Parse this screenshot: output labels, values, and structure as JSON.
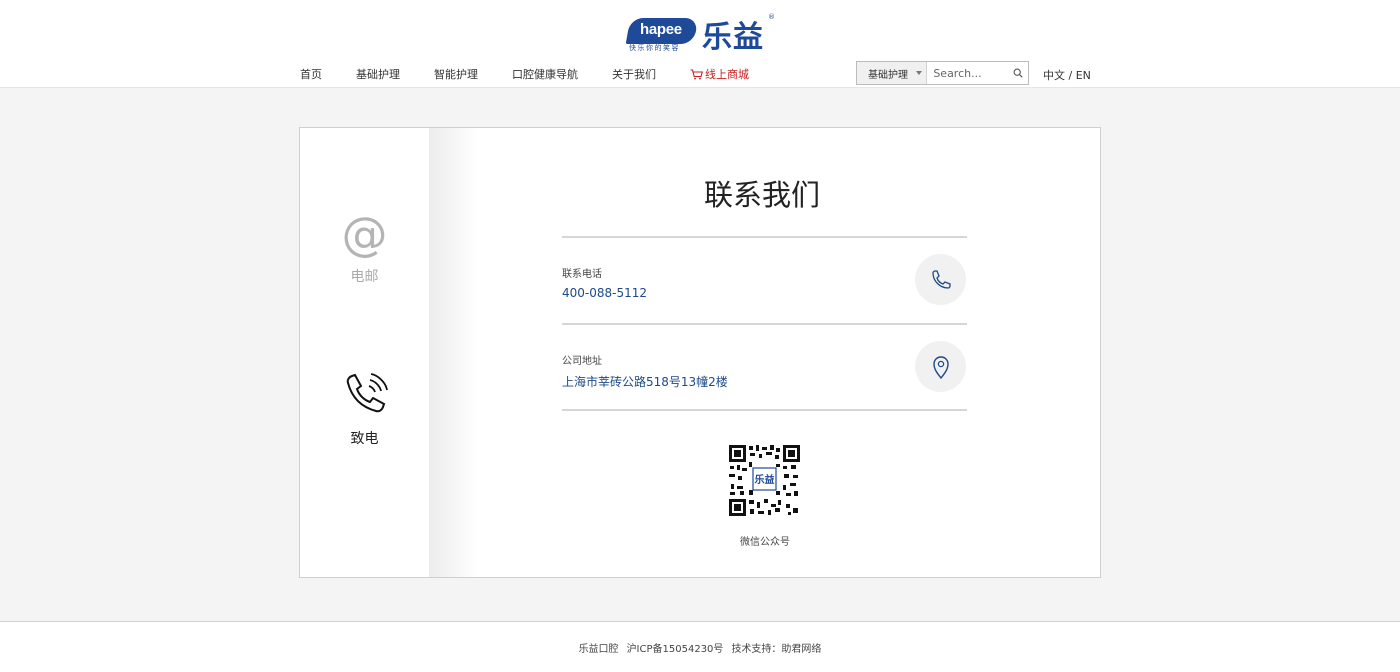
{
  "logo": {
    "en": "hapee",
    "cn": "乐益",
    "slogan": "快乐你的笑容",
    "reg_mark": "®"
  },
  "nav": {
    "items": [
      {
        "label": "首页"
      },
      {
        "label": "基础护理"
      },
      {
        "label": "智能护理"
      },
      {
        "label": "口腔健康导航"
      },
      {
        "label": "关于我们"
      }
    ],
    "shop_label": "线上商城"
  },
  "search": {
    "category": "基础护理",
    "placeholder": "Search..."
  },
  "lang": "中文 / EN",
  "side": {
    "email_label": "电邮",
    "call_label": "致电"
  },
  "contact": {
    "title": "联系我们",
    "phone_label": "联系电话",
    "phone_value": "400-088-5112",
    "address_label": "公司地址",
    "address_value": "上海市莘砖公路518号13幢2楼",
    "qr_label": "微信公众号"
  },
  "footer": {
    "brand": "乐益口腔",
    "icp": "沪ICP备15054230号",
    "support": "技术支持：助君网络"
  },
  "colors": {
    "brand_blue": "#1e4a99",
    "link_blue": "#1e4a87",
    "shop_red": "#c81e1e"
  },
  "icons": [
    "cart-icon",
    "search-icon",
    "at-icon",
    "phone-ring-icon",
    "phone-icon",
    "location-pin-icon",
    "qr-code"
  ]
}
